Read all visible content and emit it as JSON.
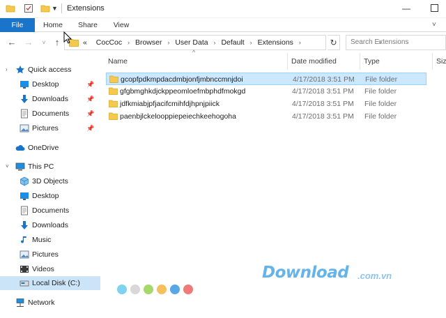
{
  "window": {
    "title": "Extensions",
    "minimize_glyph": "—"
  },
  "ribbon": {
    "tabs": [
      "File",
      "Home",
      "Share",
      "View"
    ]
  },
  "navigation": {
    "breadcrumb_prefix": "«",
    "breadcrumb": [
      "CocCoc",
      "Browser",
      "User Data",
      "Default",
      "Extensions"
    ],
    "search_placeholder": "Search Extensions"
  },
  "sidebar": {
    "quick_access": {
      "label": "Quick access",
      "items": [
        {
          "label": "Desktop",
          "icon": "desktop-icon",
          "pinned": true
        },
        {
          "label": "Downloads",
          "icon": "downloads-icon",
          "pinned": true
        },
        {
          "label": "Documents",
          "icon": "documents-icon",
          "pinned": true
        },
        {
          "label": "Pictures",
          "icon": "pictures-icon",
          "pinned": true
        }
      ]
    },
    "onedrive": {
      "label": "OneDrive"
    },
    "this_pc": {
      "label": "This PC",
      "items": [
        {
          "label": "3D Objects",
          "icon": "3d-objects-icon"
        },
        {
          "label": "Desktop",
          "icon": "desktop-icon"
        },
        {
          "label": "Documents",
          "icon": "documents-icon"
        },
        {
          "label": "Downloads",
          "icon": "downloads-icon"
        },
        {
          "label": "Music",
          "icon": "music-icon"
        },
        {
          "label": "Pictures",
          "icon": "pictures-icon"
        },
        {
          "label": "Videos",
          "icon": "videos-icon"
        },
        {
          "label": "Local Disk (C:)",
          "icon": "local-disk-icon",
          "selected": true
        }
      ]
    },
    "network": {
      "label": "Network"
    }
  },
  "file_list": {
    "columns": [
      "Name",
      "Date modified",
      "Type",
      "Siz"
    ],
    "rows": [
      {
        "name": "gcopfpdkmpdacdmbjonfjmbnccmnjdoi",
        "date": "4/17/2018 3:51 PM",
        "type": "File folder",
        "selected": true
      },
      {
        "name": "gfgbmghkdjckppeomloefmbphdfmokgd",
        "date": "4/17/2018 3:51 PM",
        "type": "File folder",
        "selected": false
      },
      {
        "name": "jdfkmiabjpfjacifcmihfdjhpnjpiick",
        "date": "4/17/2018 3:51 PM",
        "type": "File folder",
        "selected": false
      },
      {
        "name": "paenbjlckelooppiepeiechkeehogoha",
        "date": "4/17/2018 3:51 PM",
        "type": "File folder",
        "selected": false
      }
    ]
  },
  "watermark": {
    "text": "Download",
    "suffix": ".com.vn",
    "dot_colors": [
      "#7fd2f0",
      "#d8d8d8",
      "#a7d86a",
      "#f6c05e",
      "#58a8e8",
      "#f07a7a"
    ]
  },
  "colors": {
    "accent": "#1a74c9",
    "selection": "#cce8ff",
    "folder": "#f5c94d"
  }
}
